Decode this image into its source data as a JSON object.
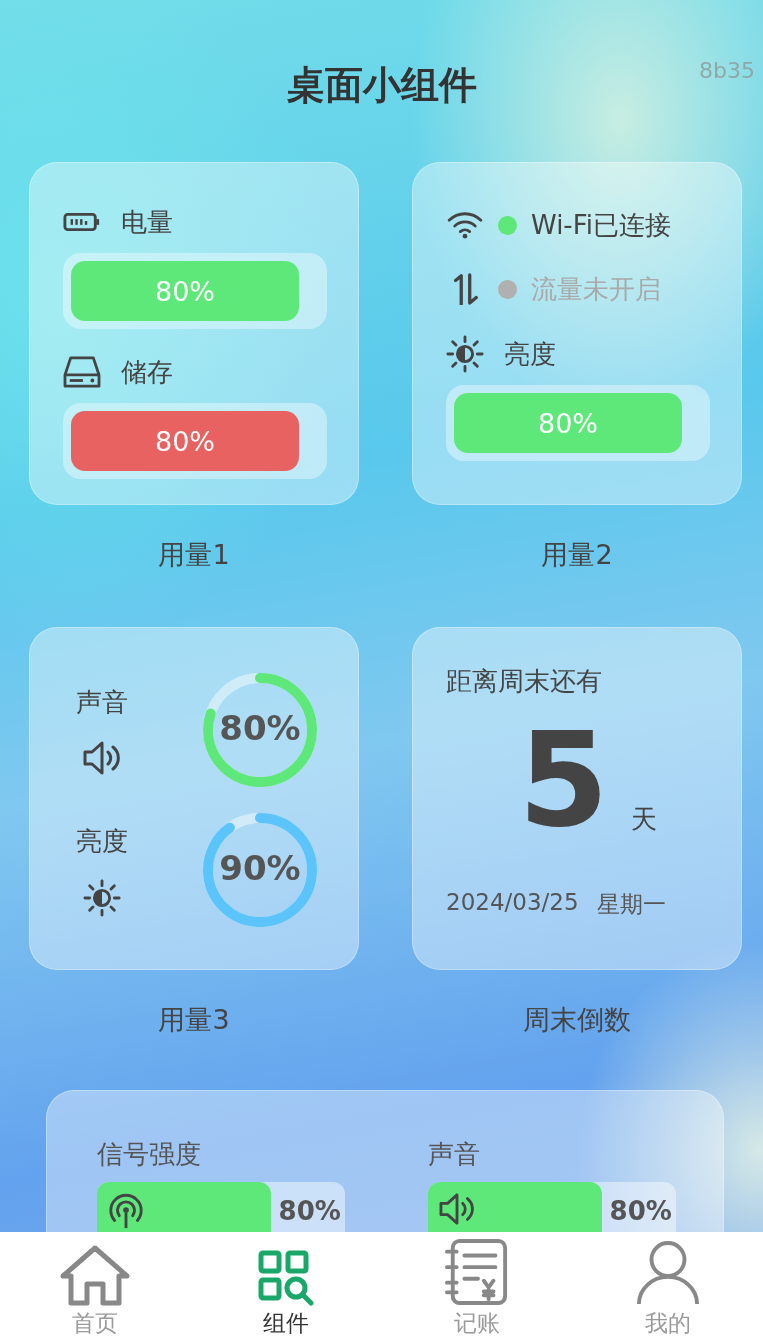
{
  "header": {
    "title": "桌面小组件",
    "tag": "8b35"
  },
  "usage1": {
    "caption": "用量1",
    "items": [
      {
        "label": "电量",
        "reading": "80%",
        "color": "#5fe87a"
      },
      {
        "label": "储存",
        "reading": "80%",
        "color": "#e86262"
      }
    ]
  },
  "usage2": {
    "caption": "用量2",
    "statuses": [
      {
        "label": "Wi-Fi已连接",
        "on": true
      },
      {
        "label": "流量未开启",
        "on": false
      }
    ],
    "brightness": {
      "label": "亮度",
      "reading": "80%",
      "color": "#5fe87a"
    }
  },
  "usage3": {
    "caption": "用量3",
    "items": [
      {
        "label": "声音",
        "level": 0.8,
        "reading": "80%",
        "color": "#5fe87a"
      },
      {
        "label": "亮度",
        "level": 0.9,
        "reading": "90%",
        "color": "#5bc4fa"
      }
    ]
  },
  "countdown": {
    "caption": "周末倒数",
    "title": "距离周末还有",
    "number": "5",
    "unit": "天",
    "date": "2024/03/25",
    "weekday": "星期一"
  },
  "signal_card": {
    "items": [
      {
        "label": "信号强度",
        "level": 0.7,
        "reading": "80%"
      },
      {
        "label": "声音",
        "level": 0.7,
        "reading": "80%"
      }
    ]
  },
  "tab_bar": [
    {
      "label": "首页",
      "selected": false
    },
    {
      "label": "组件",
      "selected": true
    },
    {
      "label": "记账",
      "selected": false
    },
    {
      "label": "我的",
      "selected": false
    }
  ]
}
